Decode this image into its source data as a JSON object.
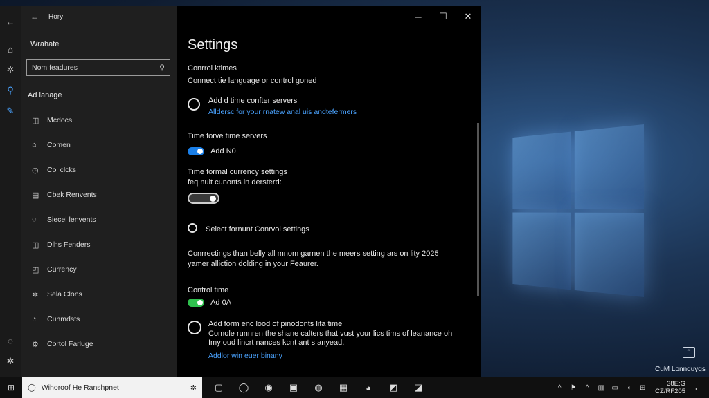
{
  "desktop": {
    "icon_label": "CuM Lonnduygs",
    "icon_glyph": "⌃"
  },
  "window": {
    "rail_icons": [
      "back-arrow-icon",
      "home-icon",
      "settings-icon",
      "person-icon",
      "pen-icon",
      "info-icon",
      "accessibility-icon"
    ],
    "back_glyph": "←",
    "breadcrumb": "Hory",
    "app_name": "Wrahate",
    "search_placeholder": "Nom feadures",
    "section_heading": "Ad lanage",
    "nav_items": [
      {
        "icon": "calendar-icon",
        "glyph": "◫",
        "label": "Mcdocs"
      },
      {
        "icon": "camera-icon",
        "glyph": "⌂",
        "label": "Comen"
      },
      {
        "icon": "clock-icon",
        "glyph": "◷",
        "label": "Col clcks"
      },
      {
        "icon": "list-icon",
        "glyph": "▤",
        "label": "Cbek Renvents"
      },
      {
        "icon": "region-icon",
        "glyph": "◌",
        "label": "Siecel lenvents"
      },
      {
        "icon": "region-alt-icon",
        "glyph": "◫",
        "label": "Dlhs Fenders"
      },
      {
        "icon": "currency-icon",
        "glyph": "◰",
        "label": "Currency"
      },
      {
        "icon": "gear-icon",
        "glyph": "✲",
        "label": "Sela Clons"
      },
      {
        "icon": "comment-icon",
        "glyph": "◔",
        "label": "Cunmdsts"
      },
      {
        "icon": "settings-icon",
        "glyph": "⚙",
        "label": "Cortol Farluge"
      }
    ],
    "controls": {
      "minimize": "─",
      "maximize": "☐",
      "close": "✕"
    },
    "title": "Settings",
    "sec1_title": "Conrrol ktimes",
    "sec1_desc": "Connect tie language or control goned",
    "option1_title": "Add d time confter servers",
    "option1_link": "Alldersc for your rnatew anal uis andtefermers",
    "sec2_title": "Time forve time servers",
    "toggle1_label": "Add  N0",
    "sec3_title": "Time formal currency settings",
    "sec3_desc": "feq nuit cunonts in dersterd:",
    "option2_title": "Select fornunt Conrvol settings",
    "paragraph_line1": "Conrrectings than belly all mnom garnen the meers setting ars on lity 2025",
    "paragraph_line2": "yamer alliction dolding in your Feaurer.",
    "sec4_title": "Control time",
    "toggle2_label": "Ad 0A",
    "option3_title": "Add form enc lood of pinodonts lifa time",
    "option3_desc1": "Comole runnren the shane calters that vust your lics tims of leanance oh",
    "option3_desc2": "Imy oud lincrt nances kcnt ant s anyead.",
    "option3_link": "Addlor win euer binany"
  },
  "taskbar": {
    "start_glyph": "⊞",
    "search_text": "Wihoroof He Ranshpnet",
    "search_icon": "search-circle-icon",
    "mic_glyph": "✲",
    "apps": [
      {
        "icon": "task-view-icon",
        "glyph": "▢"
      },
      {
        "icon": "cortana-icon",
        "glyph": "◯"
      },
      {
        "icon": "edge-icon",
        "glyph": "◉"
      },
      {
        "icon": "files-icon",
        "glyph": "▣"
      },
      {
        "icon": "chrome-icon",
        "glyph": "◍"
      },
      {
        "icon": "folder-icon",
        "glyph": "▦"
      },
      {
        "icon": "app-green-icon",
        "glyph": "◕"
      },
      {
        "icon": "app-blue-icon",
        "glyph": "◩"
      },
      {
        "icon": "app-settings-icon",
        "glyph": "◪"
      }
    ],
    "tray": [
      {
        "icon": "chevron-up-icon",
        "glyph": "^"
      },
      {
        "icon": "flag-icon",
        "glyph": "⚑"
      },
      {
        "icon": "caret-icon",
        "glyph": "^"
      },
      {
        "icon": "network-icon",
        "glyph": "▥"
      },
      {
        "icon": "battery-icon",
        "glyph": "▭"
      },
      {
        "icon": "volume-icon",
        "glyph": "◖"
      },
      {
        "icon": "language-icon",
        "glyph": "⊞"
      }
    ],
    "clock_time": "38E:G",
    "clock_date": "CZ/RF205",
    "notification_glyph": "⌐"
  },
  "colors": {
    "accent": "#1a7fe8",
    "toggle_green": "#2fc14e",
    "link": "#4aa3ff"
  }
}
